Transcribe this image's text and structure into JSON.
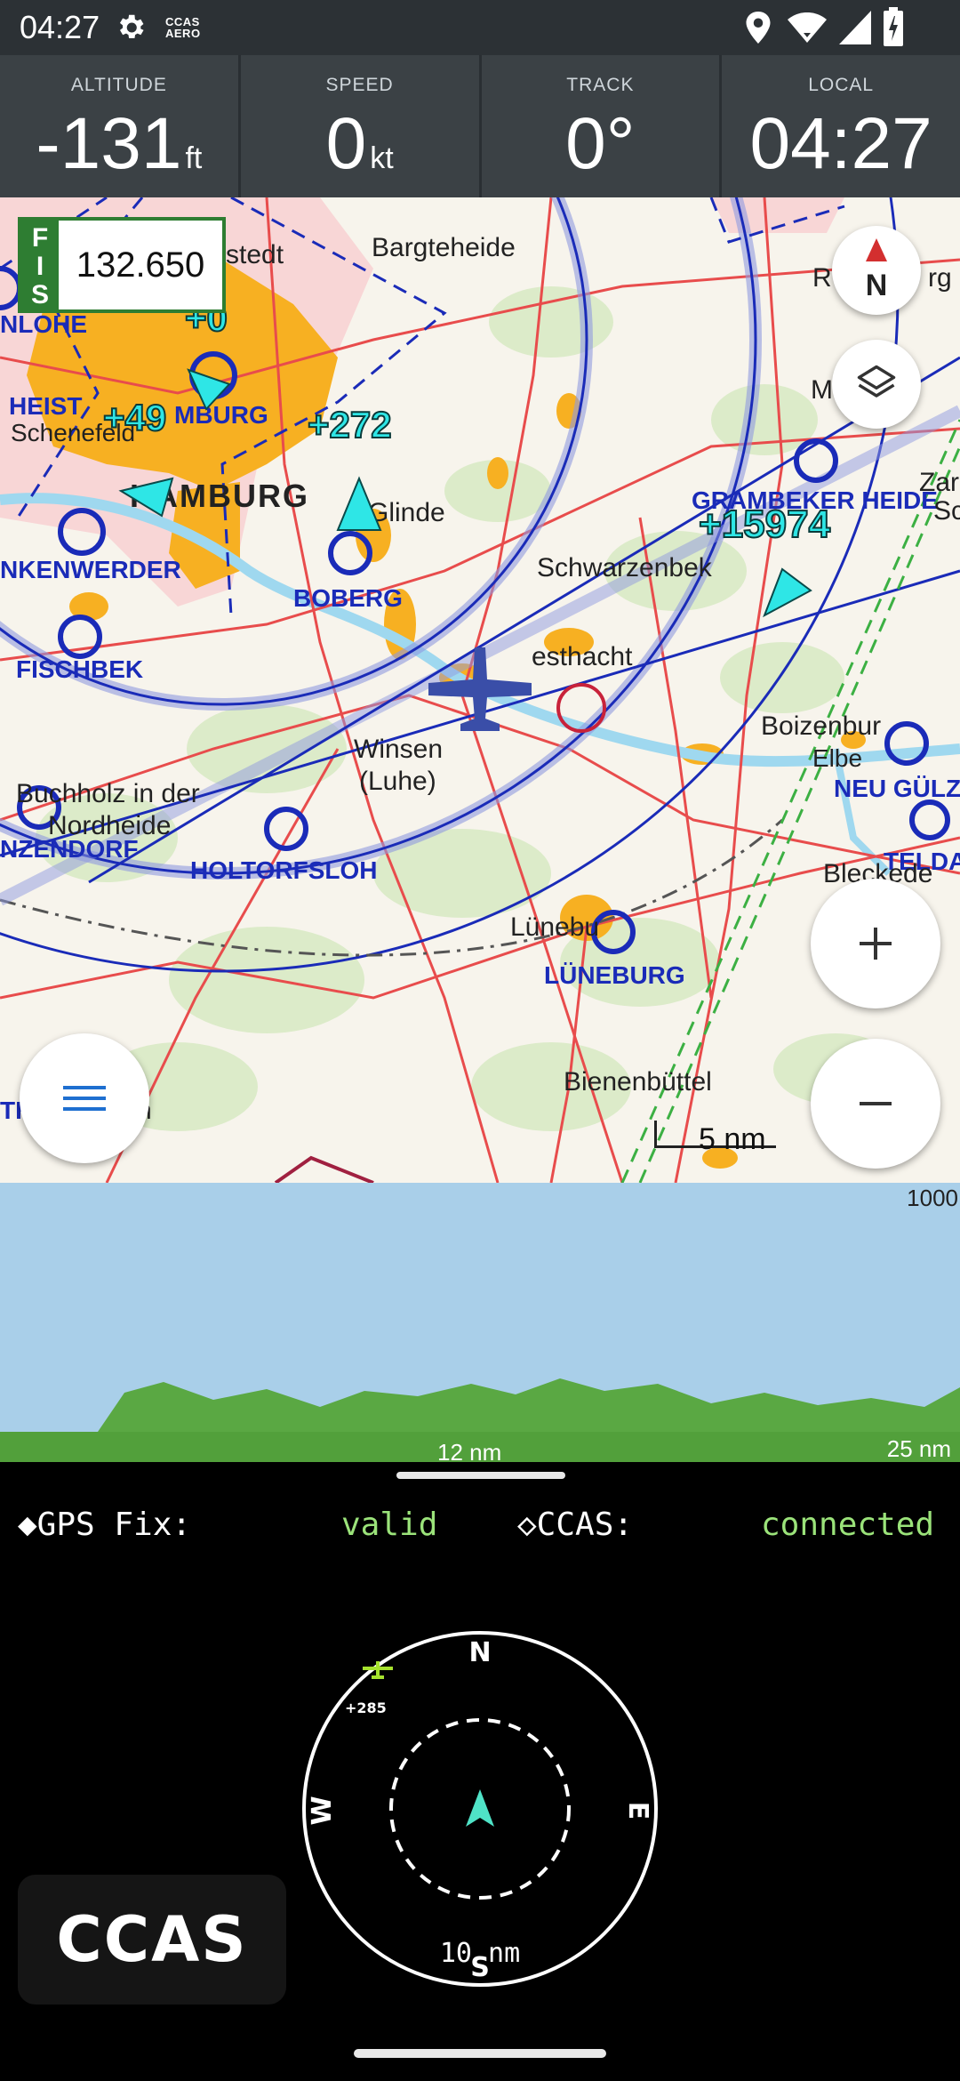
{
  "status_bar": {
    "time": "04:27",
    "ccas_aero_line1": "CCAS",
    "ccas_aero_line2": "AERO"
  },
  "info_panel": {
    "altitude": {
      "label": "ALTITUDE",
      "value": "-131",
      "unit": "ft"
    },
    "speed": {
      "label": "SPEED",
      "value": "0",
      "unit": "kt"
    },
    "track": {
      "label": "TRACK",
      "value": "0°"
    },
    "local": {
      "label": "LOCAL",
      "value": "04:27"
    }
  },
  "map": {
    "fis": {
      "label_f": "F",
      "label_i": "I",
      "label_s": "S",
      "frequency": "132.650"
    },
    "north_label": "N",
    "scale_label": "5 nm",
    "places": {
      "bargteheide": "Bargteheide",
      "stedt": "stedt",
      "nlohe": "NLOHE",
      "heist": "HEIST",
      "schenefeld": "Schenefeld",
      "hamburg_city": "HAMBURG",
      "hamburg_airport": "MBURG",
      "glinde": "Glinde",
      "boberg": "BOBERG",
      "finkenwerder": "NKENWERDER",
      "fischbek": "FISCHBEK",
      "schwarzenbek": "Schwarzenbek",
      "geesthacht": "esthacht",
      "winsen1": "Winsen",
      "winsen2": "(Luhe)",
      "buchholz": "Buchholz in der",
      "nordheide": "Nordheide",
      "nzendorf": "NZENDORF",
      "holtorfsloh": "HOLTORFSLOH",
      "grambeker": "GRAMBEKER HEIDE",
      "boizenburg": "Boizenbur",
      "elbe": "Elbe",
      "neu_gulz": "NEU GÜLZ",
      "telda": "TELDA",
      "bleckede": "Bleckede",
      "luneburg_town": "Lünebu",
      "luneburg_airport": "LÜNEBURG",
      "bienenbuttel": "Bienenbüttel",
      "ratzeburg_partial": "R",
      "ratzeburg_partial2": "rg",
      "molln": "Möll",
      "zarr": "Zar",
      "sc": "Sc",
      "th": "TH",
      "n_partial": "n"
    },
    "traffic": [
      {
        "label": "+0"
      },
      {
        "label": "+49"
      },
      {
        "label": "+272"
      },
      {
        "label": "+15974"
      }
    ]
  },
  "profile": {
    "top_label": "1000",
    "mid_label": "12 nm",
    "end_label": "25 nm"
  },
  "ccas_panel": {
    "gps_fix_label": "◆GPS Fix:",
    "gps_fix_value": "valid",
    "ccas_label": "◇CCAS:",
    "ccas_value": "connected",
    "radar": {
      "north": "N",
      "east": "E",
      "south": "S",
      "west": "W",
      "range": "10 nm",
      "target_label": "+285"
    },
    "logo_text": "CCAS"
  },
  "colors": {
    "status_bar": "#2c3135",
    "info_panel": "#3b4145",
    "traffic": "#2ee6e6",
    "airspace_blue": "#1a2bb8",
    "fis_green": "#2e7d32",
    "terrain_green": "#5aa843",
    "value_green": "#9be37a"
  },
  "icons": [
    "settings-gear-icon",
    "location-icon",
    "wifi-icon",
    "signal-icon",
    "battery-icon",
    "north-arrow-icon",
    "layers-icon",
    "plus-icon",
    "minus-icon",
    "menu-icon",
    "ownship-airplane-icon",
    "traffic-arrow-icon"
  ]
}
